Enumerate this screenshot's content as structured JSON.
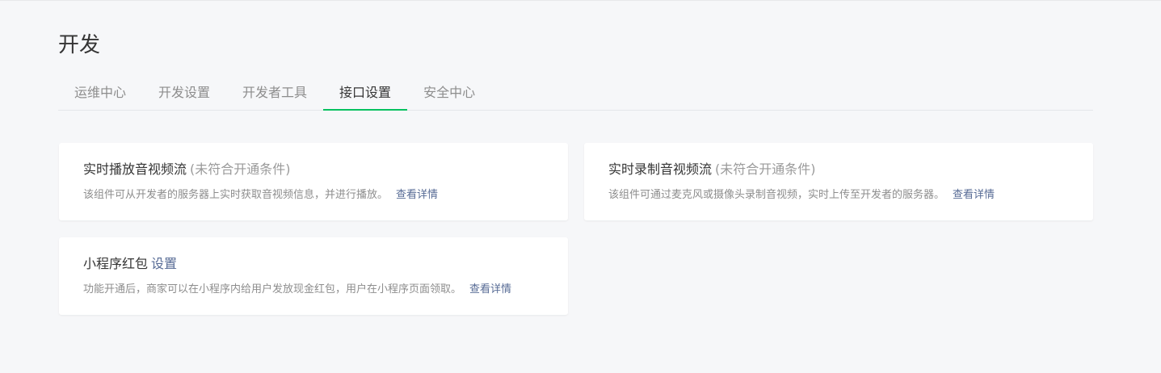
{
  "page": {
    "title": "开发"
  },
  "tabs": [
    {
      "label": "运维中心",
      "active": false
    },
    {
      "label": "开发设置",
      "active": false
    },
    {
      "label": "开发者工具",
      "active": false
    },
    {
      "label": "接口设置",
      "active": true
    },
    {
      "label": "安全中心",
      "active": false
    }
  ],
  "cards": [
    {
      "title": "实时播放音视频流",
      "status": "(未符合开通条件)",
      "description": "该组件可从开发者的服务器上实时获取音视频信息，并进行播放。",
      "link": "查看详情"
    },
    {
      "title": "实时录制音视频流",
      "status": "(未符合开通条件)",
      "description": "该组件可通过麦克风或摄像头录制音视频，实时上传至开发者的服务器。",
      "link": "查看详情"
    },
    {
      "title": "小程序红包",
      "action": "设置",
      "description": "功能开通后，商家可以在小程序内给用户发放现金红包，用户在小程序页面领取。",
      "link": "查看详情"
    }
  ],
  "colors": {
    "accent": "#07c160",
    "link": "#576b95",
    "muted": "#8d8d8d",
    "background": "#f6f7f9"
  }
}
